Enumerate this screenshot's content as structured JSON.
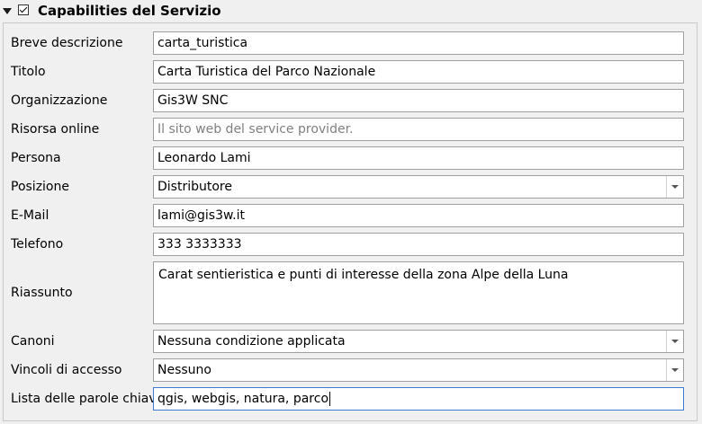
{
  "group": {
    "title": "Capabilities del Servizio",
    "checked": true
  },
  "fields": {
    "breve_descrizione": {
      "label": "Breve descrizione",
      "value": "carta_turistica"
    },
    "titolo": {
      "label": "Titolo",
      "value": "Carta Turistica del Parco Nazionale"
    },
    "organizzazione": {
      "label": "Organizzazione",
      "value": "Gis3W SNC"
    },
    "risorsa_online": {
      "label": "Risorsa online",
      "placeholder": "Il sito web del service provider."
    },
    "persona": {
      "label": "Persona",
      "value": "Leonardo Lami"
    },
    "posizione": {
      "label": "Posizione",
      "value": "Distributore"
    },
    "email": {
      "label": "E-Mail",
      "value": "lami@gis3w.it"
    },
    "telefono": {
      "label": "Telefono",
      "value": "333 3333333"
    },
    "riassunto": {
      "label": "Riassunto",
      "value": "Carat sentieristica e punti di interesse della zona Alpe della Luna"
    },
    "canoni": {
      "label": "Canoni",
      "value": "Nessuna condizione applicata"
    },
    "vincoli": {
      "label": "Vincoli di accesso",
      "value": "Nessuno"
    },
    "parole_chiave": {
      "label": "Lista delle parole chiave",
      "value": "qgis, webgis, natura, parco"
    }
  }
}
